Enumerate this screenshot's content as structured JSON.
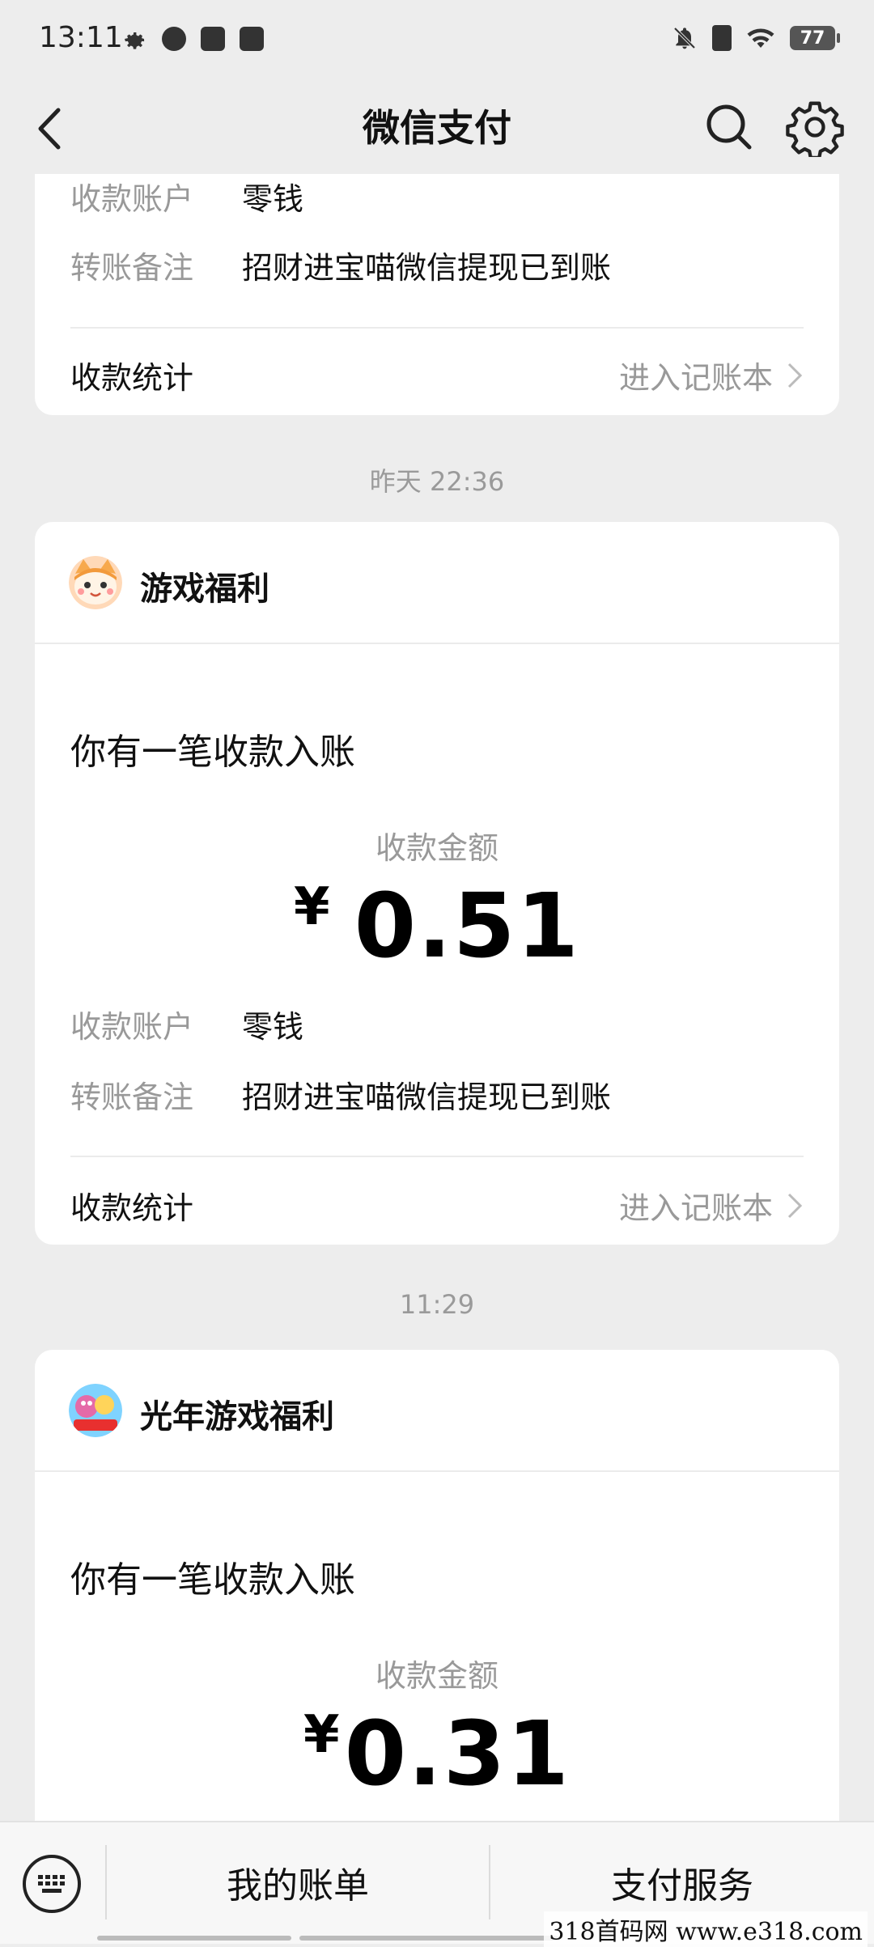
{
  "status_bar": {
    "time": "13:11",
    "battery": "77"
  },
  "nav": {
    "title": "微信支付"
  },
  "messages": [
    {
      "account_label": "收款账户",
      "account_value": "零钱",
      "remark_label": "转账备注",
      "remark_value": "招财进宝喵微信提现已到账",
      "stats_label": "收款统计",
      "stats_link": "进入记账本"
    },
    {
      "timestamp": "昨天 22:36",
      "app_name": "游戏福利",
      "notice": "你有一笔收款入账",
      "amount_label": "收款金额",
      "currency": "¥",
      "amount": "0.51",
      "account_label": "收款账户",
      "account_value": "零钱",
      "remark_label": "转账备注",
      "remark_value": "招财进宝喵微信提现已到账",
      "stats_label": "收款统计",
      "stats_link": "进入记账本"
    },
    {
      "timestamp": "11:29",
      "app_name": "光年游戏福利",
      "notice": "你有一笔收款入账",
      "amount_label": "收款金额",
      "currency": "¥",
      "amount": "0.31"
    }
  ],
  "bottom_bar": {
    "bill_label": "我的账单",
    "service_label": "支付服务"
  },
  "watermark": "318首码网  www.e318.com"
}
